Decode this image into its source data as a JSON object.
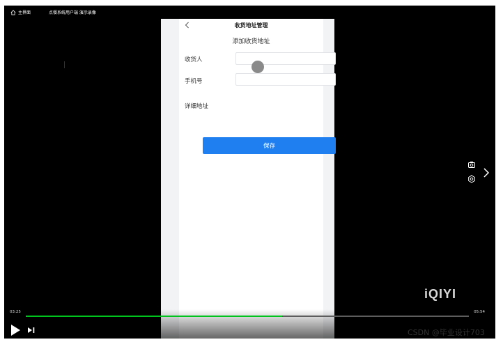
{
  "topbar": {
    "home_label": "主界面",
    "video_title": "点餐系统用户端 演示录像"
  },
  "phone": {
    "header_title": "收货地址管理",
    "subtitle": "添加收货地址",
    "form": {
      "receiver_label": "收货人",
      "receiver_value": "",
      "phone_label": "手机号",
      "phone_value": "",
      "address_label": "详细地址"
    },
    "save_label": "保存"
  },
  "player": {
    "logo": "iQIYI",
    "current_time": "03:25",
    "total_time": "05:54",
    "progress_fraction": 0.578
  },
  "watermark": "CSDN @毕业设计703",
  "icons": [
    "home-icon",
    "back-chevron-icon",
    "camera-icon",
    "settings-icon",
    "next-chevron-icon",
    "play-icon",
    "next-track-icon"
  ],
  "colors": {
    "primary": "#1f7ff1",
    "progress": "#00c41e",
    "background": "#000000"
  }
}
